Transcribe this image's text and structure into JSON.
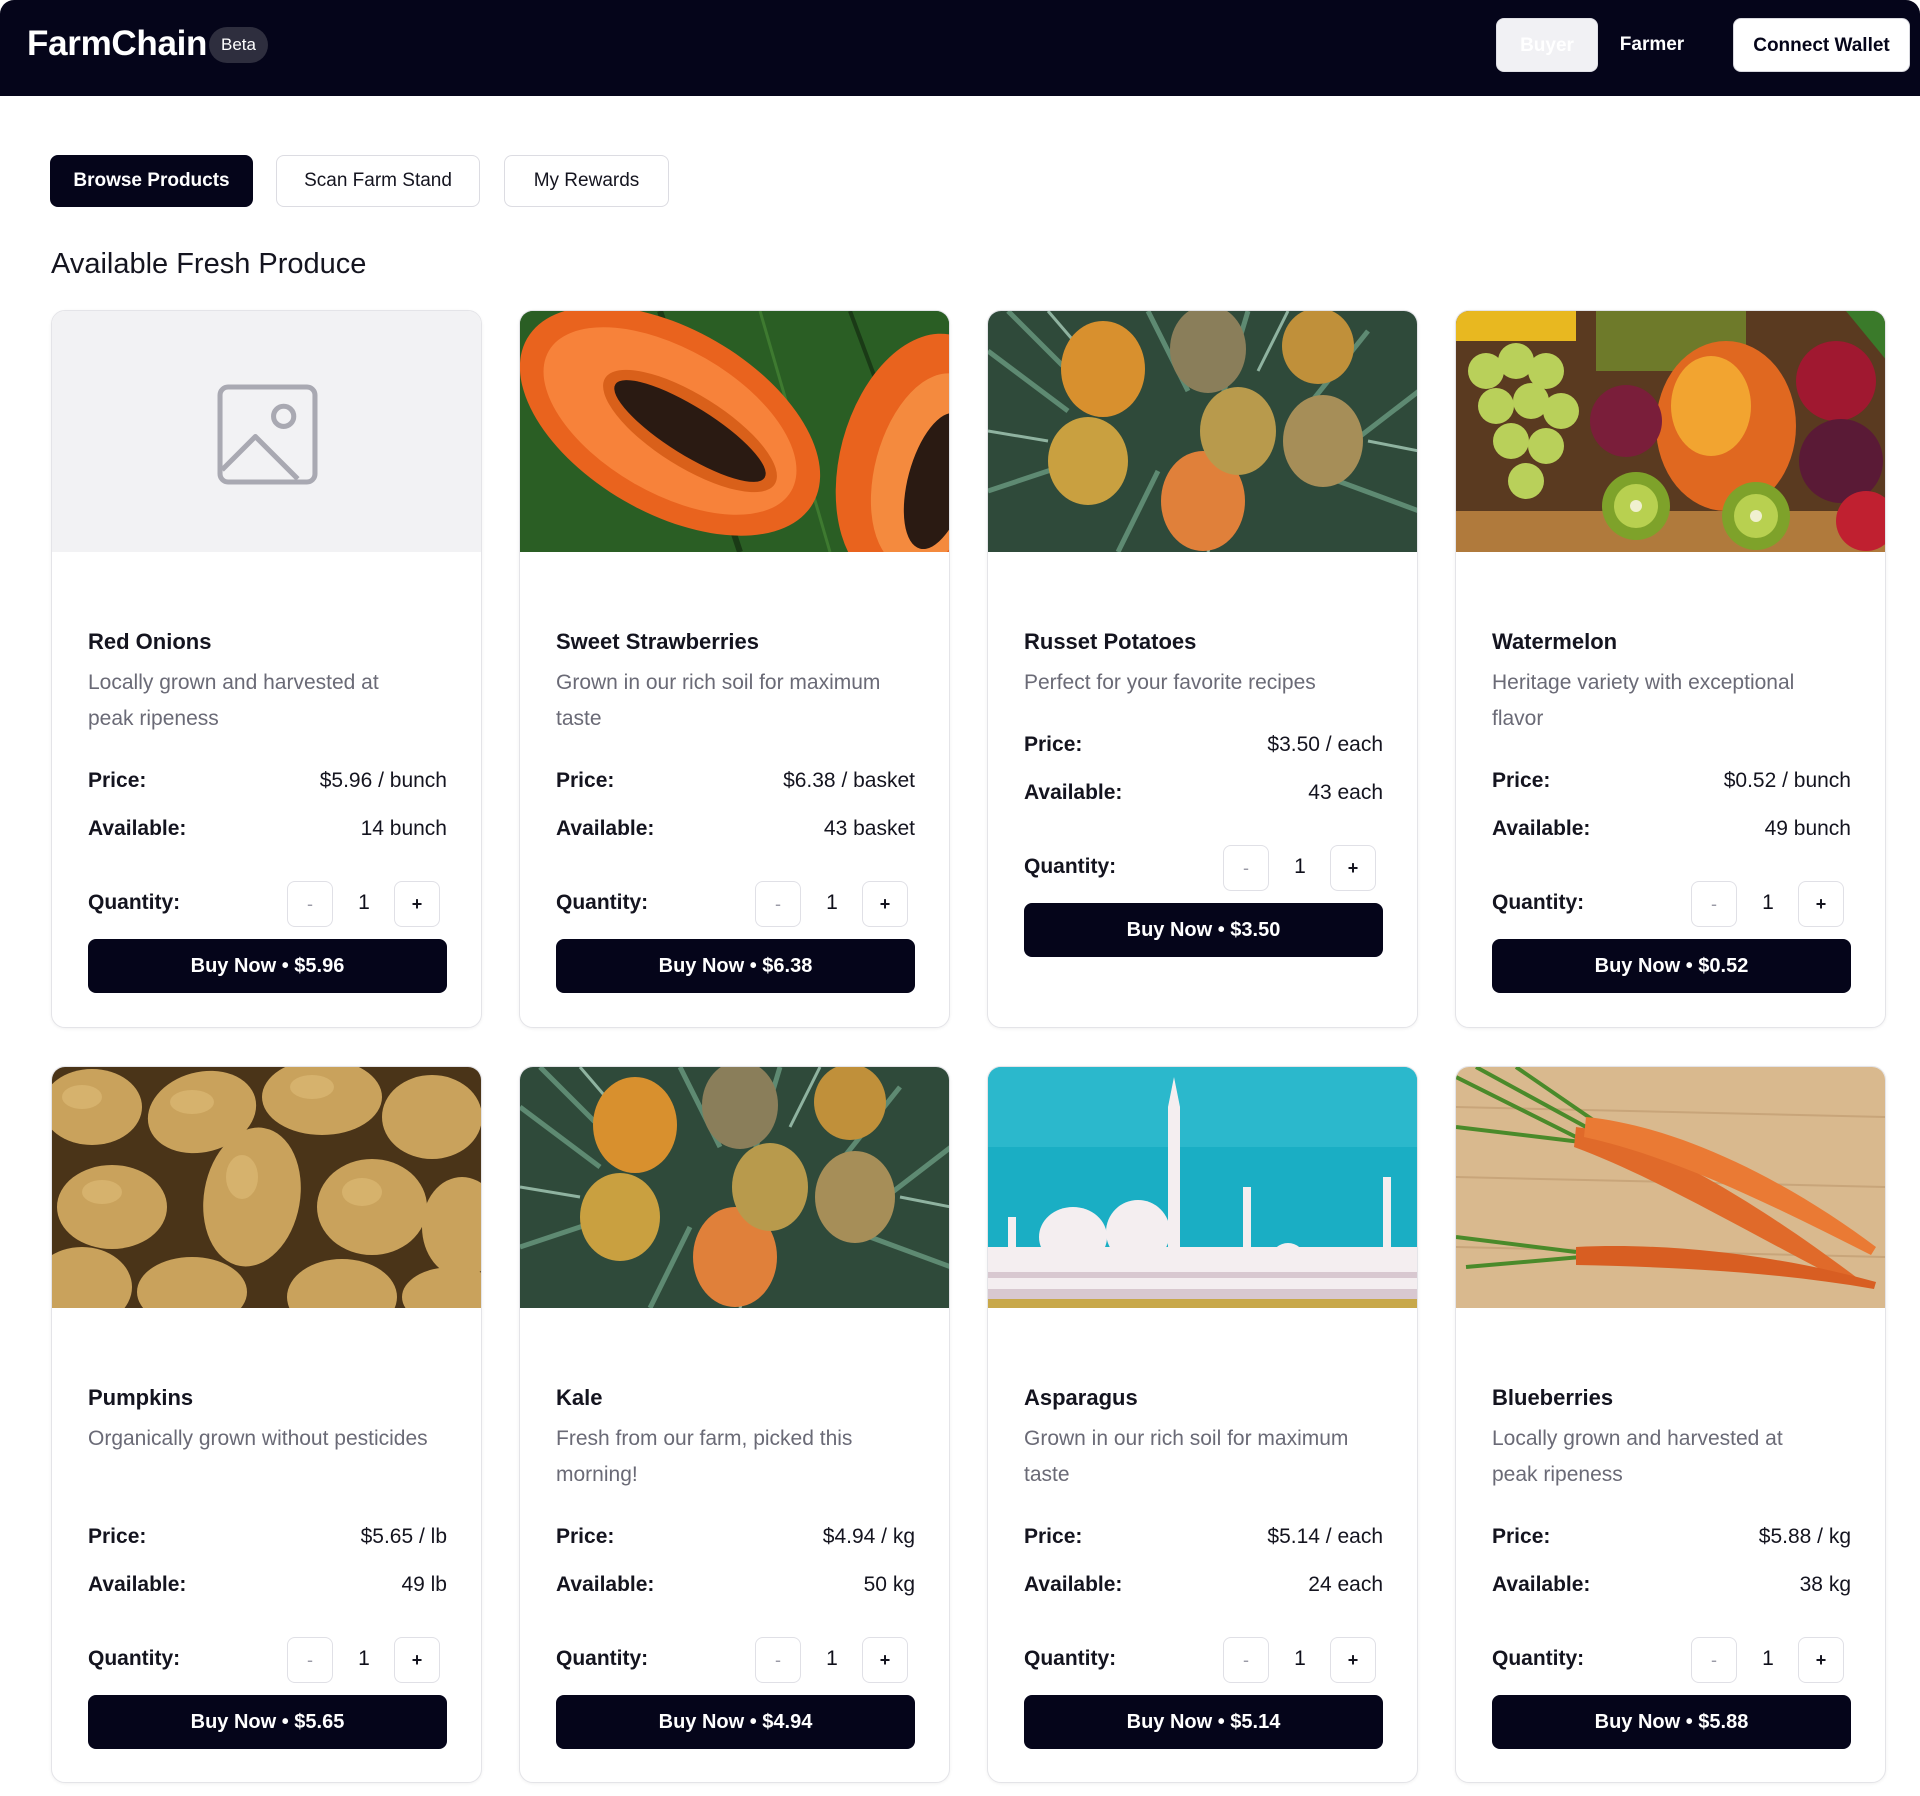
{
  "header": {
    "brand": "FarmChain",
    "badge": "Beta",
    "role_buyer": "Buyer",
    "role_farmer": "Farmer",
    "connect_wallet": "Connect Wallet"
  },
  "tabs": [
    "Browse Products",
    "Scan Farm Stand",
    "My Rewards"
  ],
  "section_title": "Available Fresh Produce",
  "labels": {
    "price": "Price:",
    "available": "Available:",
    "quantity": "Quantity:",
    "minus": "-",
    "plus": "+"
  },
  "products": [
    {
      "name": "Red Onions",
      "description": "Locally grown and harvested at peak ripeness",
      "price": "$5.96 / bunch",
      "available": "14 bunch",
      "quantity": "1",
      "buy": "Buy Now • $5.96",
      "image": "image-placeholder-icon"
    },
    {
      "name": "Sweet Strawberries",
      "description": "Grown in our rich soil for maximum taste",
      "price": "$6.38 / basket",
      "available": "43 basket",
      "quantity": "1",
      "buy": "Buy Now • $6.38",
      "image": "papaya-photo"
    },
    {
      "name": "Russet Potatoes",
      "description": "Perfect for your favorite recipes",
      "price": "$3.50 / each",
      "available": "43 each",
      "quantity": "1",
      "buy": "Buy Now • $3.50",
      "image": "pineapples-photo"
    },
    {
      "name": "Watermelon",
      "description": "Heritage variety with exceptional flavor",
      "price": "$0.52 / bunch",
      "available": "49 bunch",
      "quantity": "1",
      "buy": "Buy Now • $0.52",
      "image": "fruit-basket-photo"
    },
    {
      "name": "Pumpkins",
      "description": "Organically grown without pesticides",
      "price": "$5.65 / lb",
      "available": "49 lb",
      "quantity": "1",
      "buy": "Buy Now • $5.65",
      "image": "potatoes-photo"
    },
    {
      "name": "Kale",
      "description": "Fresh from our farm, picked this morning!",
      "price": "$4.94 / kg",
      "available": "50 kg",
      "quantity": "1",
      "buy": "Buy Now • $4.94",
      "image": "pineapples-photo"
    },
    {
      "name": "Asparagus",
      "description": "Grown in our rich soil for maximum taste",
      "price": "$5.14 / each",
      "available": "24 each",
      "quantity": "1",
      "buy": "Buy Now • $5.14",
      "image": "mosque-photo"
    },
    {
      "name": "Blueberries",
      "description": "Locally grown and harvested at peak ripeness",
      "price": "$5.88 / kg",
      "available": "38 kg",
      "quantity": "1",
      "buy": "Buy Now • $5.88",
      "image": "carrots-photo"
    }
  ]
}
